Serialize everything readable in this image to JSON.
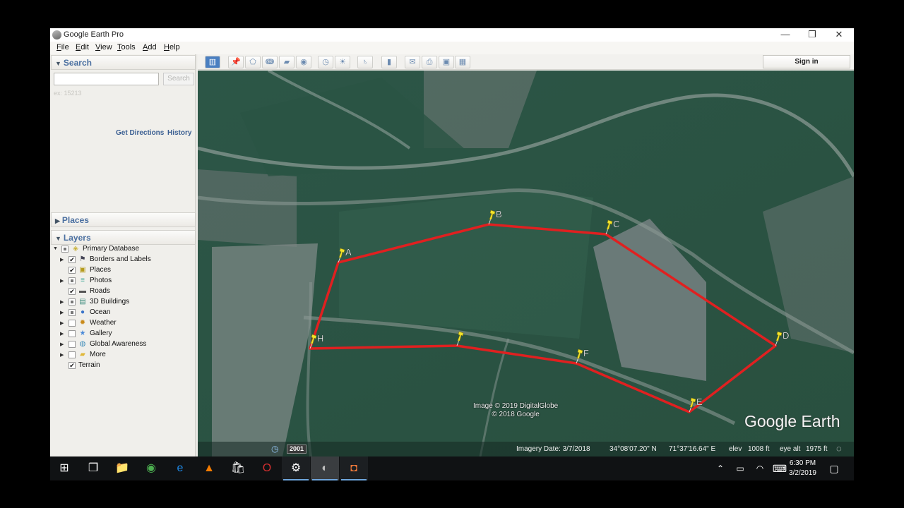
{
  "window": {
    "title": "Google Earth Pro",
    "controls": {
      "minimize": "—",
      "restore": "❐",
      "close": "✕"
    }
  },
  "menu": [
    "File",
    "Edit",
    "View",
    "Tools",
    "Add",
    "Help"
  ],
  "sidebar": {
    "search": {
      "header": "Search",
      "input_value": "",
      "button": "Search",
      "hint": "ex: 15213",
      "get_directions": "Get Directions",
      "history": "History"
    },
    "places": {
      "header": "Places"
    },
    "layers": {
      "header": "Layers",
      "items": [
        {
          "label": "Primary Database",
          "state": "partial",
          "icon": "database-icon",
          "expand": "open",
          "level": 0
        },
        {
          "label": "Borders and Labels",
          "state": "checked",
          "icon": "flag-icon",
          "expand": "closed",
          "level": 1
        },
        {
          "label": "Places",
          "state": "checked",
          "icon": "places-icon",
          "expand": "none",
          "level": 1
        },
        {
          "label": "Photos",
          "state": "partial",
          "icon": "photos-icon",
          "expand": "closed",
          "level": 1
        },
        {
          "label": "Roads",
          "state": "checked",
          "icon": "roads-icon",
          "expand": "none",
          "level": 1
        },
        {
          "label": "3D Buildings",
          "state": "partial",
          "icon": "buildings-icon",
          "expand": "closed",
          "level": 1
        },
        {
          "label": "Ocean",
          "state": "partial",
          "icon": "ocean-icon",
          "expand": "closed",
          "level": 1
        },
        {
          "label": "Weather",
          "state": "unchecked",
          "icon": "weather-icon",
          "expand": "closed",
          "level": 1
        },
        {
          "label": "Gallery",
          "state": "unchecked",
          "icon": "gallery-icon",
          "expand": "closed",
          "level": 1
        },
        {
          "label": "Global Awareness",
          "state": "unchecked",
          "icon": "globe-icon",
          "expand": "closed",
          "level": 1
        },
        {
          "label": "More",
          "state": "unchecked",
          "icon": "more-icon",
          "expand": "closed",
          "level": 1
        },
        {
          "label": "Terrain",
          "state": "checked",
          "icon": "",
          "expand": "none",
          "level": 0
        }
      ]
    }
  },
  "toolbar": {
    "buttons": [
      {
        "name": "hide-sidebar-button",
        "glyph": "▥"
      },
      {
        "name": "add-placemark-button",
        "glyph": "📌"
      },
      {
        "name": "add-polygon-button",
        "glyph": "⬠"
      },
      {
        "name": "add-path-button",
        "glyph": "ↈ"
      },
      {
        "name": "add-image-overlay-button",
        "glyph": "▰"
      },
      {
        "name": "record-tour-button",
        "glyph": "◉"
      },
      {
        "name": "historical-imagery-button",
        "glyph": "◷"
      },
      {
        "name": "sunlight-button",
        "glyph": "☀"
      },
      {
        "name": "switch-planet-button",
        "glyph": "♄"
      },
      {
        "name": "ruler-button",
        "glyph": "▮"
      },
      {
        "name": "email-button",
        "glyph": "✉"
      },
      {
        "name": "print-button",
        "glyph": "⎙"
      },
      {
        "name": "save-image-button",
        "glyph": "▣"
      },
      {
        "name": "view-in-maps-button",
        "glyph": "▦"
      }
    ],
    "sign_in": "Sign in"
  },
  "map": {
    "placemarks": [
      {
        "label": "A"
      },
      {
        "label": "B"
      },
      {
        "label": "C"
      },
      {
        "label": "D"
      },
      {
        "label": "E"
      },
      {
        "label": "F"
      },
      {
        "label": ""
      },
      {
        "label": "H"
      }
    ],
    "path_color": "#e02020",
    "pin_color": "#f2e52a",
    "attribution_line1": "Image © 2019 DigitalGlobe",
    "attribution_line2": "© 2018 Google",
    "logo": "Google Earth"
  },
  "statusbar": {
    "historical_year": "2001",
    "imagery_date": "Imagery Date: 3/7/2018",
    "latitude": "34°08'07.20\" N",
    "longitude": "71°37'16.64\" E",
    "elev_label": "elev",
    "elev_value": "1008 ft",
    "eye_alt_label": "eye alt",
    "eye_alt_value": "1975 ft"
  },
  "taskbar": {
    "apps": [
      {
        "name": "start-button",
        "glyph": "⊞",
        "active": false
      },
      {
        "name": "task-view-button",
        "glyph": "❐",
        "active": false
      },
      {
        "name": "file-explorer-app",
        "glyph": "📁",
        "active": false
      },
      {
        "name": "chrome-app",
        "glyph": "◉",
        "active": false
      },
      {
        "name": "edge-app",
        "glyph": "e",
        "active": false
      },
      {
        "name": "vlc-app",
        "glyph": "▲",
        "active": false
      },
      {
        "name": "store-app",
        "glyph": "🛍",
        "active": false
      },
      {
        "name": "opera-app",
        "glyph": "O",
        "active": false
      },
      {
        "name": "settings-app",
        "glyph": "⚙",
        "active": true
      },
      {
        "name": "google-earth-app",
        "glyph": "◐",
        "active": true
      },
      {
        "name": "screen-recorder-app",
        "glyph": "◘",
        "active": true
      }
    ],
    "tray": {
      "chevron": "⌃",
      "battery": "▭",
      "wifi": "◠",
      "keyboard": "⌨",
      "notifications": "▢"
    },
    "time": "6:30 PM",
    "date": "3/2/2019"
  }
}
